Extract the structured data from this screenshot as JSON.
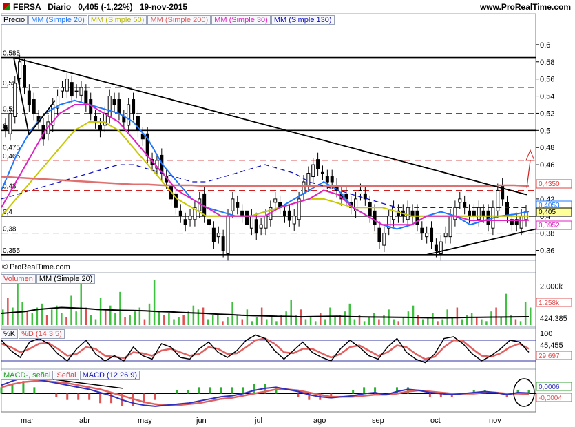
{
  "header": {
    "ticker": "FERSA",
    "period": "Diario",
    "quote": "0,405 (-1,22%)",
    "date": "19-nov-2015",
    "site": "www.ProRealTime.com"
  },
  "legends": {
    "price": [
      "Precio",
      "MM (Simple 20)",
      "MM (Simple 50)",
      "MM (Simple 200)",
      "MM (Simple 30)",
      "MM (Simple 130)"
    ],
    "price_colors": [
      "#000000",
      "#1e78ff",
      "#c8c800",
      "#e06060",
      "#e020c0",
      "#1010c0"
    ],
    "volume": [
      "Volumen",
      "MM (Simple 20)"
    ],
    "stoch": [
      "%K",
      "%D (14 3 5)"
    ],
    "macd": [
      "MACD-, señal",
      "Señal",
      "MACD (12 26 9)"
    ]
  },
  "copyright": "© ProRealTime.com",
  "chart_data": [
    {
      "type": "line",
      "name": "price",
      "ylim": [
        0.35,
        0.62
      ],
      "y_ticks": [
        "0,6",
        "0,58",
        "0,56",
        "0,54",
        "0,52",
        "0,5",
        "0,48",
        "0,46",
        "0,44",
        "0,42",
        "0,4",
        "0,38",
        "0,36"
      ],
      "tick_values": [
        0.6,
        0.58,
        0.56,
        0.54,
        0.52,
        0.5,
        0.48,
        0.46,
        0.44,
        0.42,
        0.4,
        0.38,
        0.36
      ],
      "months": [
        "mar",
        "abr",
        "may",
        "jun",
        "jul",
        "ago",
        "sep",
        "oct",
        "nov"
      ],
      "levels_solid": [
        0.585,
        0.5,
        0.4,
        0.355
      ],
      "levels_dashed": [
        0.55,
        0.52,
        0.475,
        0.465,
        0.43,
        0.38
      ],
      "level_labels": [
        "0,585",
        "0,55",
        "0,52",
        "0,5",
        "0,475",
        "0,465",
        "0,43",
        "0,4",
        "0,38",
        "0,355"
      ],
      "value_boxes": [
        {
          "text": "0,4350",
          "color": "#e04040",
          "value": 0.435
        },
        {
          "text": "0,4053",
          "color": "#1e78ff",
          "value": 0.4053
        },
        {
          "text": "0,405",
          "color": "#000000",
          "value": 0.405
        },
        {
          "text": "0,3952",
          "color": "#e020c0",
          "value": 0.3952
        }
      ],
      "close": [
        0.5,
        0.52,
        0.555,
        0.58,
        0.55,
        0.53,
        0.52,
        0.51,
        0.49,
        0.51,
        0.53,
        0.54,
        0.55,
        0.56,
        0.54,
        0.545,
        0.55,
        0.53,
        0.52,
        0.51,
        0.5,
        0.52,
        0.54,
        0.53,
        0.52,
        0.51,
        0.53,
        0.52,
        0.5,
        0.49,
        0.47,
        0.46,
        0.465,
        0.45,
        0.44,
        0.42,
        0.41,
        0.4,
        0.39,
        0.4,
        0.41,
        0.42,
        0.4,
        0.39,
        0.37,
        0.38,
        0.36,
        0.4,
        0.42,
        0.41,
        0.4,
        0.39,
        0.4,
        0.38,
        0.39,
        0.4,
        0.41,
        0.42,
        0.41,
        0.4,
        0.395,
        0.4,
        0.42,
        0.44,
        0.45,
        0.46,
        0.455,
        0.45,
        0.44,
        0.44,
        0.43,
        0.42,
        0.42,
        0.41,
        0.42,
        0.43,
        0.42,
        0.4,
        0.39,
        0.37,
        0.38,
        0.4,
        0.41,
        0.4,
        0.4,
        0.41,
        0.4,
        0.39,
        0.38,
        0.38,
        0.37,
        0.36,
        0.37,
        0.38,
        0.4,
        0.41,
        0.42,
        0.41,
        0.4,
        0.4,
        0.41,
        0.4,
        0.39,
        0.41,
        0.43,
        0.42,
        0.4,
        0.39,
        0.39,
        0.4,
        0.405
      ],
      "series": [
        {
          "name": "MM (Simple 20)",
          "values": [
            0.43,
            0.47,
            0.5,
            0.52,
            0.53,
            0.535,
            0.53,
            0.525,
            0.52,
            0.51,
            0.49,
            0.46,
            0.44,
            0.42,
            0.41,
            0.405,
            0.4,
            0.4,
            0.405,
            0.41,
            0.42,
            0.43,
            0.44,
            0.43,
            0.41,
            0.4,
            0.39,
            0.385,
            0.39,
            0.4,
            0.405,
            0.4,
            0.39,
            0.395,
            0.4,
            0.402,
            0.4053
          ]
        },
        {
          "name": "MM (Simple 50)",
          "values": [
            0.4,
            0.42,
            0.44,
            0.46,
            0.48,
            0.5,
            0.51,
            0.51,
            0.5,
            0.48,
            0.46,
            0.44,
            0.42,
            0.41,
            0.4,
            0.4,
            0.4,
            0.4,
            0.405,
            0.41,
            0.415,
            0.42,
            0.42,
            0.415,
            0.41,
            0.41,
            0.41,
            0.405,
            0.4,
            0.4,
            0.4,
            0.4,
            0.4,
            0.4,
            0.4,
            0.4,
            0.4
          ]
        },
        {
          "name": "MM (Simple 200)",
          "values": [
            0.446,
            0.445,
            0.444,
            0.443,
            0.442,
            0.441,
            0.44,
            0.439,
            0.438,
            0.437,
            0.437,
            0.436,
            0.436,
            0.436,
            0.435,
            0.435,
            0.435,
            0.435,
            0.435,
            0.435,
            0.435,
            0.435,
            0.435,
            0.435,
            0.435,
            0.435,
            0.435,
            0.435,
            0.435,
            0.435,
            0.435,
            0.435,
            0.435,
            0.435,
            0.436,
            0.436,
            0.435
          ]
        },
        {
          "name": "MM (Simple 30)",
          "values": [
            0.41,
            0.44,
            0.47,
            0.5,
            0.52,
            0.53,
            0.53,
            0.52,
            0.51,
            0.49,
            0.47,
            0.45,
            0.43,
            0.42,
            0.41,
            0.4,
            0.4,
            0.4,
            0.4,
            0.41,
            0.415,
            0.42,
            0.43,
            0.425,
            0.41,
            0.4,
            0.39,
            0.39,
            0.39,
            0.4,
            0.4,
            0.4,
            0.395,
            0.395,
            0.395,
            0.395,
            0.3952
          ]
        },
        {
          "name": "MM (Simple 130)",
          "values": [
            0.42,
            0.425,
            0.43,
            0.435,
            0.44,
            0.445,
            0.45,
            0.455,
            0.46,
            0.46,
            0.455,
            0.45,
            0.445,
            0.44,
            0.44,
            0.445,
            0.45,
            0.455,
            0.46,
            0.455,
            0.45,
            0.44,
            0.435,
            0.43,
            0.425,
            0.42,
            0.415,
            0.41,
            0.41,
            0.41,
            0.41,
            0.41,
            0.41,
            0.41,
            0.41,
            0.41,
            0.41
          ]
        }
      ]
    },
    {
      "type": "bar",
      "name": "volume",
      "ylim": [
        0,
        2400000
      ],
      "y_ticks": [
        "2.000k"
      ],
      "value_labels": [
        "1.258k",
        "424.385"
      ],
      "values": [
        800,
        1400,
        900,
        2100,
        1200,
        700,
        600,
        900,
        1100,
        500,
        800,
        1000,
        600,
        400,
        1500,
        700,
        2200,
        900,
        500,
        300,
        1400,
        800,
        1000,
        600,
        1700,
        400,
        500,
        700,
        900,
        300,
        1100,
        2300,
        700,
        500,
        600,
        300,
        400,
        500,
        700,
        1000,
        800,
        900,
        300,
        500,
        600,
        200,
        400,
        1200,
        500,
        300,
        800,
        200,
        400,
        900,
        300,
        400,
        200,
        500,
        700,
        1300,
        500,
        800,
        300,
        400,
        200,
        600,
        300,
        900,
        400,
        500,
        700,
        1100,
        300,
        500,
        200,
        400,
        600,
        300,
        500,
        800,
        300,
        200,
        400,
        700,
        1000,
        500,
        300,
        400,
        600,
        200,
        300,
        800,
        400,
        900,
        300,
        500,
        600,
        400,
        300,
        200,
        700,
        900,
        400,
        1600,
        500,
        300,
        200,
        1200,
        900
      ],
      "ma": [
        600,
        650,
        700,
        800,
        850,
        900,
        880,
        850,
        800,
        780,
        760,
        750,
        730,
        700,
        680,
        650,
        620,
        600,
        560,
        540,
        500,
        480,
        470,
        450,
        440,
        420,
        430,
        440,
        450,
        430,
        420,
        410,
        405,
        400,
        390,
        380,
        370,
        370,
        380,
        390,
        400,
        405,
        410,
        420,
        424
      ]
    },
    {
      "type": "line",
      "name": "stochastic",
      "ylim": [
        0,
        100
      ],
      "y_ticks": [
        "100"
      ],
      "value_labels": [
        "45,455",
        "29,697"
      ],
      "k": [
        80,
        50,
        30,
        75,
        85,
        70,
        40,
        20,
        55,
        80,
        40,
        20,
        35,
        20,
        60,
        35,
        25,
        70,
        60,
        30,
        25,
        55,
        75,
        45,
        30,
        50,
        80,
        95,
        85,
        50,
        25,
        50,
        75,
        45,
        30,
        20,
        55,
        80,
        60,
        35,
        25,
        60,
        85,
        45,
        25,
        15,
        40,
        85,
        90,
        70,
        40,
        20,
        35,
        55,
        80,
        75,
        45
      ],
      "d": [
        70,
        60,
        45,
        55,
        70,
        72,
        55,
        35,
        40,
        60,
        55,
        35,
        32,
        28,
        45,
        42,
        35,
        50,
        55,
        45,
        35,
        40,
        60,
        55,
        40,
        42,
        60,
        80,
        85,
        70,
        45,
        42,
        55,
        55,
        42,
        30,
        40,
        60,
        65,
        50,
        35,
        45,
        65,
        60,
        40,
        25,
        32,
        60,
        80,
        78,
        55,
        35,
        32,
        42,
        60,
        70,
        55
      ]
    },
    {
      "type": "line",
      "name": "macd",
      "value_labels": [
        "0,0006",
        "-0,0004"
      ],
      "macd": [
        0.008,
        0.012,
        0.015,
        0.014,
        0.012,
        0.01,
        0.008,
        0.006,
        0.004,
        0.001,
        -0.002,
        -0.006,
        -0.009,
        -0.011,
        -0.012,
        -0.011,
        -0.01,
        -0.009,
        -0.007,
        -0.005,
        -0.003,
        -0.002,
        0.0,
        0.003,
        0.005,
        0.006,
        0.004,
        0.002,
        -0.001,
        -0.003,
        -0.004,
        -0.003,
        -0.002,
        0.0,
        0.001,
        -0.001,
        0.002,
        0.004,
        0.003,
        0.001,
        0.0,
        -0.001,
        0.0,
        0.001,
        0.002,
        0.001,
        -0.001,
        0.001,
        0.0006
      ],
      "signal": [
        0.006,
        0.009,
        0.011,
        0.012,
        0.012,
        0.011,
        0.01,
        0.008,
        0.006,
        0.004,
        0.001,
        -0.002,
        -0.005,
        -0.008,
        -0.01,
        -0.011,
        -0.011,
        -0.01,
        -0.009,
        -0.007,
        -0.005,
        -0.004,
        -0.002,
        0.0,
        0.002,
        0.004,
        0.004,
        0.003,
        0.001,
        -0.001,
        -0.003,
        -0.003,
        -0.003,
        -0.002,
        -0.001,
        -0.001,
        0.0,
        0.002,
        0.003,
        0.002,
        0.001,
        0.0,
        0.0,
        0.0,
        0.001,
        0.001,
        0.0,
        0.0,
        -0.0004
      ],
      "ylim": [
        -0.016,
        0.018
      ]
    }
  ]
}
